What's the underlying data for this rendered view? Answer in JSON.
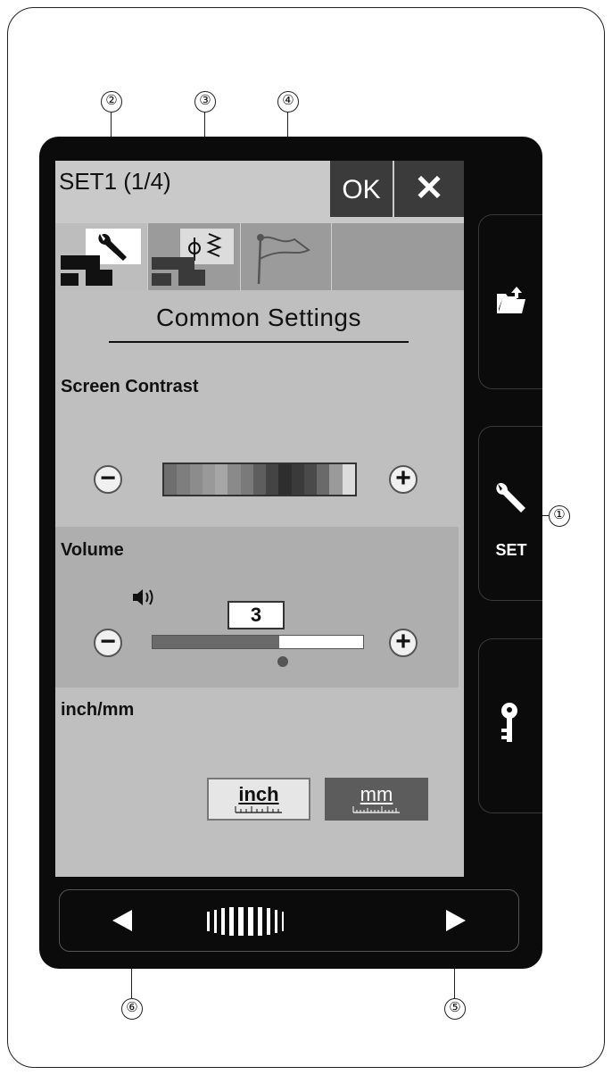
{
  "screen": {
    "title": "SET1 (1/4)",
    "ok_label": "OK",
    "close_symbol": "✕",
    "tabs": [
      {
        "name": "common-settings",
        "icon": "wrench-machine-icon"
      },
      {
        "name": "sewing-settings",
        "icon": "stitch-machine-icon"
      },
      {
        "name": "language-settings",
        "icon": "flag-icon"
      }
    ],
    "section_title": "Common Settings",
    "screen_contrast_label": "Screen Contrast",
    "volume_label": "Volume",
    "volume_value": "3",
    "volume_level_fraction": 0.6,
    "inch_mm_label": "inch/mm",
    "unit_inch_label": "inch",
    "unit_mm_label": "mm",
    "contrast_swatches": [
      "#6e6e6e",
      "#7e7e7e",
      "#8c8c8c",
      "#999999",
      "#a6a6a6",
      "#8a8a8a",
      "#7a7a7a",
      "#5e5e5e",
      "#444444",
      "#2e2e2e",
      "#3a3a3a",
      "#4a4a4a",
      "#6a6a6a",
      "#9a9a9a",
      "#dcdcdc"
    ]
  },
  "side_buttons": [
    {
      "name": "file-open",
      "icon": "folder-icon",
      "label": ""
    },
    {
      "name": "set",
      "icon": "wrench-icon",
      "label": "SET"
    },
    {
      "name": "lock",
      "icon": "key-icon",
      "label": ""
    }
  ],
  "callouts": [
    "①",
    "②",
    "③",
    "④",
    "⑤",
    "⑥"
  ]
}
